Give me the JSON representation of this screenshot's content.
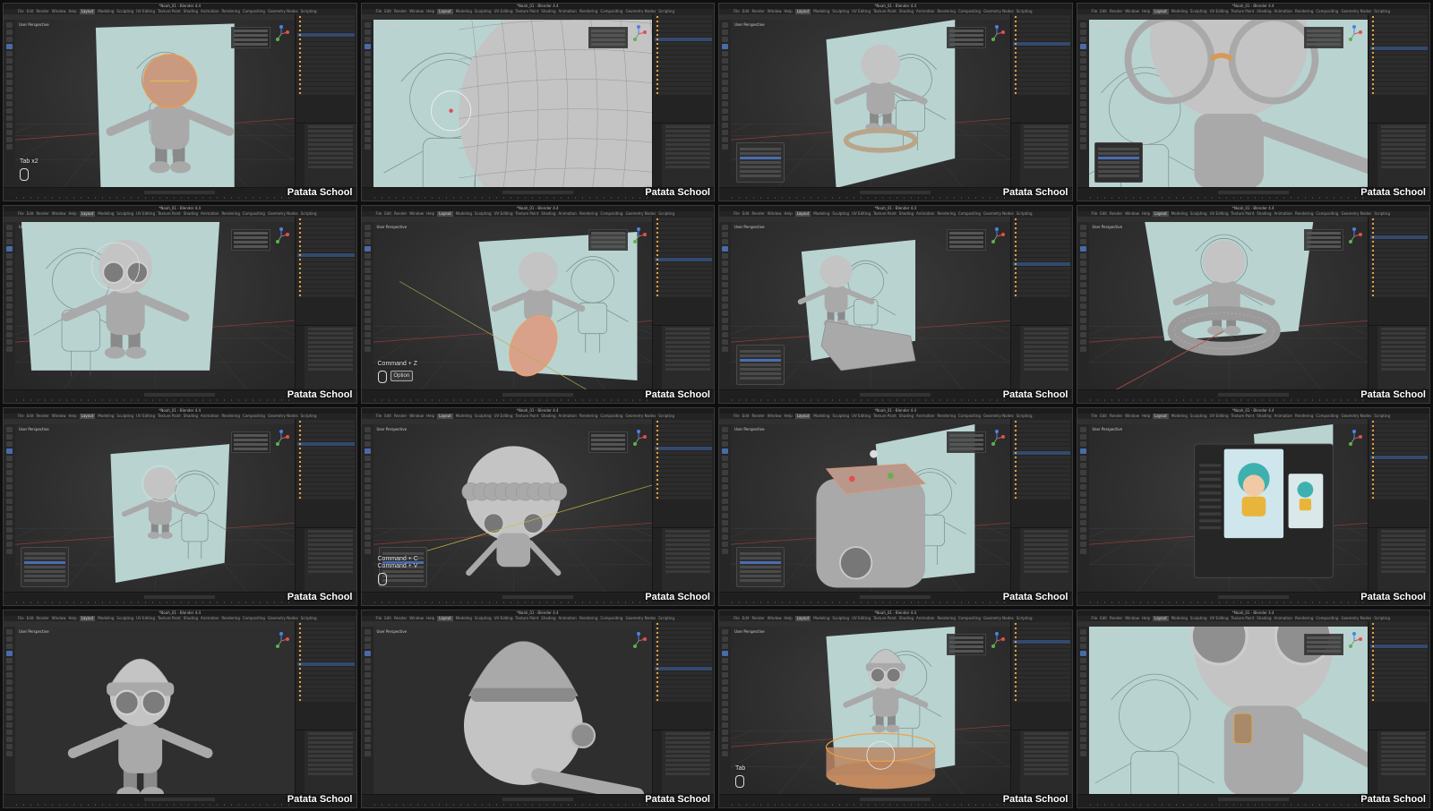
{
  "watermark": "Patata School",
  "window_title": "*Noah_01 - Blender 4.4",
  "menu_items": [
    "File",
    "Edit",
    "Render",
    "Window",
    "Help",
    "Layout",
    "Modeling",
    "Sculpting",
    "UV Editing",
    "Texture Paint",
    "Shading",
    "Animation",
    "Rendering",
    "Compositing",
    "Geometry Nodes",
    "Scripting"
  ],
  "view_label": "User Perspective",
  "tiles": [
    {
      "id": "t1",
      "hint": "Tab x2",
      "scene": "head"
    },
    {
      "id": "t2",
      "hint": "",
      "scene": "closeup"
    },
    {
      "id": "t3",
      "hint": "",
      "scene": "ring"
    },
    {
      "id": "t4",
      "hint": "",
      "scene": "glasses"
    },
    {
      "id": "t5",
      "hint": "",
      "scene": "sideglasses"
    },
    {
      "id": "t6",
      "hint": "Command + Z",
      "chip": "Option",
      "scene": "disc"
    },
    {
      "id": "t7",
      "hint": "",
      "scene": "block"
    },
    {
      "id": "t8",
      "hint": "",
      "scene": "torus"
    },
    {
      "id": "t9",
      "hint": "",
      "scene": "small"
    },
    {
      "id": "t10",
      "hint": "Command + C\nCommand + V",
      "scene": "hair"
    },
    {
      "id": "t11",
      "hint": "",
      "scene": "hat"
    },
    {
      "id": "t12",
      "hint": "",
      "scene": "dialog"
    },
    {
      "id": "t13",
      "hint": "",
      "scene": "front"
    },
    {
      "id": "t14",
      "hint": "",
      "scene": "back"
    },
    {
      "id": "t15",
      "hint": "Tab",
      "scene": "cylinder"
    },
    {
      "id": "t16",
      "hint": "",
      "scene": "scarf"
    }
  ]
}
